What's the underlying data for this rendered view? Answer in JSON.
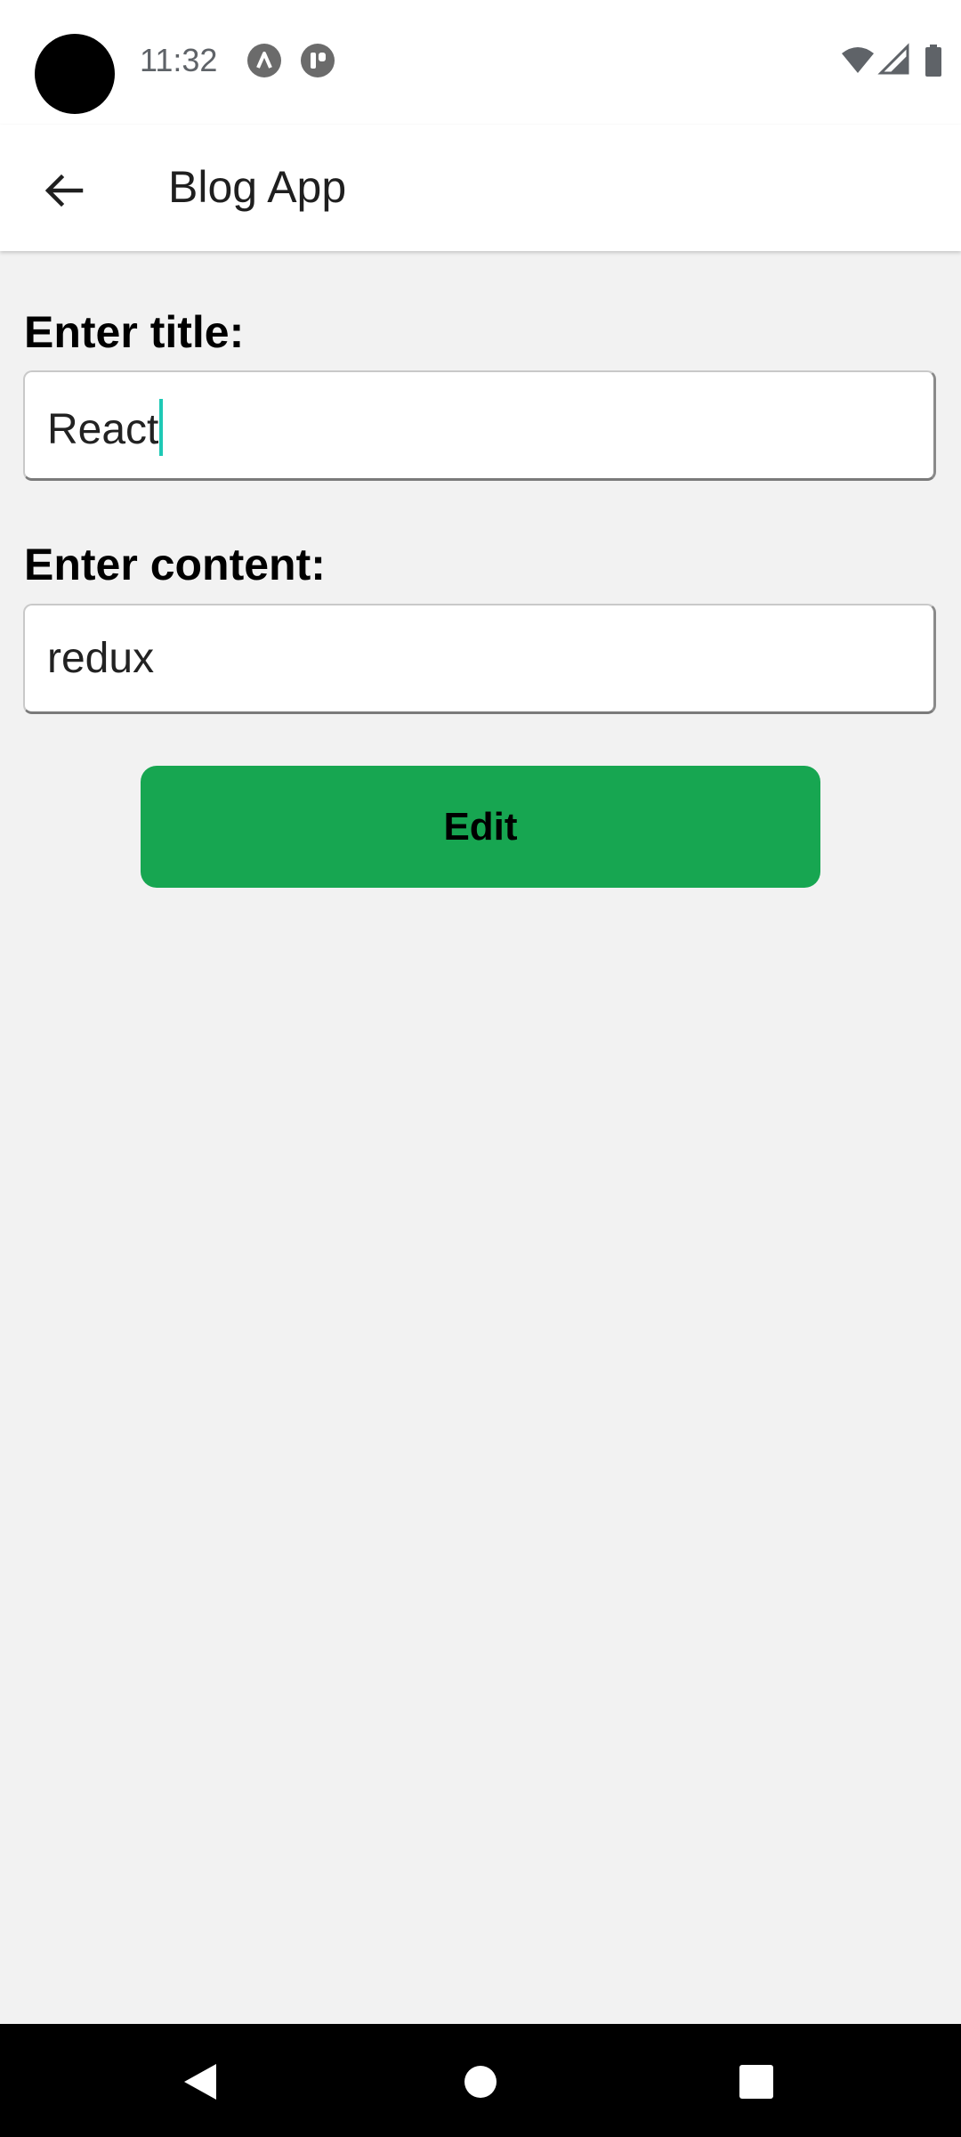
{
  "status_bar": {
    "time": "11:32",
    "notification_icons": [
      "app-notification-icon-a",
      "app-notification-icon-b"
    ],
    "system_icons": [
      "wifi-icon",
      "signal-icon",
      "battery-icon"
    ]
  },
  "app_bar": {
    "back_icon": "arrow-left-icon",
    "title": "Blog App"
  },
  "form": {
    "title_label": "Enter title:",
    "title_value": "React",
    "content_label": "Enter content:",
    "content_value": "redux",
    "submit_label": "Edit"
  },
  "colors": {
    "button": "#17a651",
    "cursor": "#1ec9b5",
    "background": "#f2f2f2"
  },
  "nav_bar": {
    "icons": [
      "nav-back-icon",
      "nav-home-icon",
      "nav-recents-icon"
    ]
  }
}
